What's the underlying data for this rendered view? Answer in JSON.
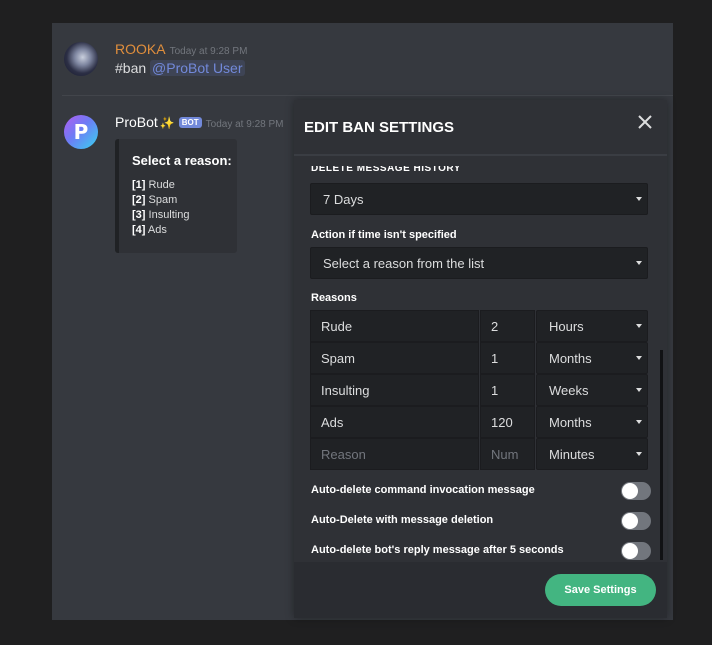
{
  "messages": [
    {
      "username": "ROOKA",
      "timestamp": "Today at 9:28 PM",
      "text": "#ban",
      "mention": "@ProBot User",
      "name_color": "#e08e3c"
    },
    {
      "username": "ProBot",
      "badge": "BOT",
      "sparkle": "✨",
      "timestamp": "Today at 9:28 PM",
      "avatar_letter": "P",
      "embed": {
        "title": "Select a reason:",
        "items": [
          {
            "key": "[1]",
            "label": "Rude"
          },
          {
            "key": "[2]",
            "label": "Spam"
          },
          {
            "key": "[3]",
            "label": "Insulting"
          },
          {
            "key": "[4]",
            "label": "Ads"
          }
        ]
      }
    }
  ],
  "modal": {
    "title": "EDIT BAN SETTINGS",
    "close_icon": "close-icon",
    "delete_history": {
      "label": "DELETE MESSAGE HISTORY",
      "value": "7 Days"
    },
    "action_unspecified": {
      "label": "Action if time isn't specified",
      "value": "Select a reason from the list"
    },
    "reasons": {
      "label": "Reasons",
      "rows": [
        {
          "reason": "Rude",
          "num": "2",
          "unit": "Hours"
        },
        {
          "reason": "Spam",
          "num": "1",
          "unit": "Months"
        },
        {
          "reason": "Insulting",
          "num": "1",
          "unit": "Weeks"
        },
        {
          "reason": "Ads",
          "num": "120",
          "unit": "Months"
        }
      ],
      "new_row": {
        "reason_placeholder": "Reason",
        "num_placeholder": "Num",
        "unit": "Minutes"
      }
    },
    "toggles": [
      {
        "label": "Auto-delete command invocation message",
        "on": false
      },
      {
        "label": "Auto-Delete with message deletion",
        "on": false
      },
      {
        "label": "Auto-delete bot's reply message after 5 seconds",
        "on": false
      }
    ],
    "save_label": "Save Settings",
    "save_color": "#43b581"
  }
}
